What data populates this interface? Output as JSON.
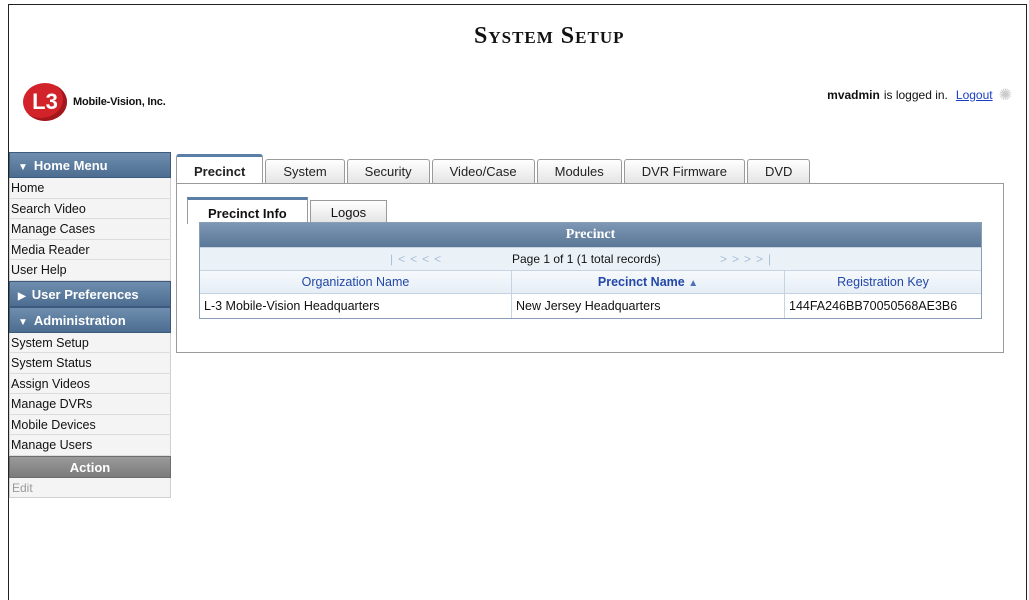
{
  "page": {
    "title": "System Setup"
  },
  "brand": {
    "logo_mark": "L3",
    "name": "Mobile-Vision, Inc.",
    "accent": "#d2232a"
  },
  "session": {
    "username": "mvadmin",
    "status_text": "is logged in.",
    "logout_label": "Logout",
    "spinner_icon": "loading-spinner-icon"
  },
  "sidebar": {
    "home_menu": {
      "label": "Home Menu",
      "items": [
        "Home",
        "Search Video",
        "Manage Cases",
        "Media Reader",
        "User Help"
      ]
    },
    "user_preferences": {
      "label": "User Preferences"
    },
    "administration": {
      "label": "Administration",
      "items": [
        "System Setup",
        "System Status",
        "Assign Videos",
        "Manage DVRs",
        "Mobile Devices",
        "Manage Users"
      ]
    },
    "action": {
      "label": "Action",
      "items": [
        "Edit"
      ]
    },
    "header_color": "#4c6d91"
  },
  "tabs": {
    "active": "Precinct",
    "items": [
      "Precinct",
      "System",
      "Security",
      "Video/Case",
      "Modules",
      "DVR Firmware",
      "DVD"
    ]
  },
  "subtabs": {
    "active": "Precinct Info",
    "items": [
      "Precinct Info",
      "Logos"
    ]
  },
  "grid": {
    "caption": "Precinct",
    "pager": {
      "first_icon": "|<",
      "prev_page_icon": "<<",
      "prev_icon": "<",
      "page_info": "Page 1 of 1 (1 total records)",
      "next_icon": ">",
      "next_page_icon": ">>",
      "last_icon": ">|"
    },
    "columns": [
      "Organization Name",
      "Precinct Name",
      "Registration Key"
    ],
    "sort_column": "Precinct Name",
    "sort_direction": "ascending",
    "rows": [
      [
        "L-3 Mobile-Vision Headquarters",
        "New Jersey Headquarters",
        "144FA246BB70050568AE3B6"
      ]
    ]
  }
}
